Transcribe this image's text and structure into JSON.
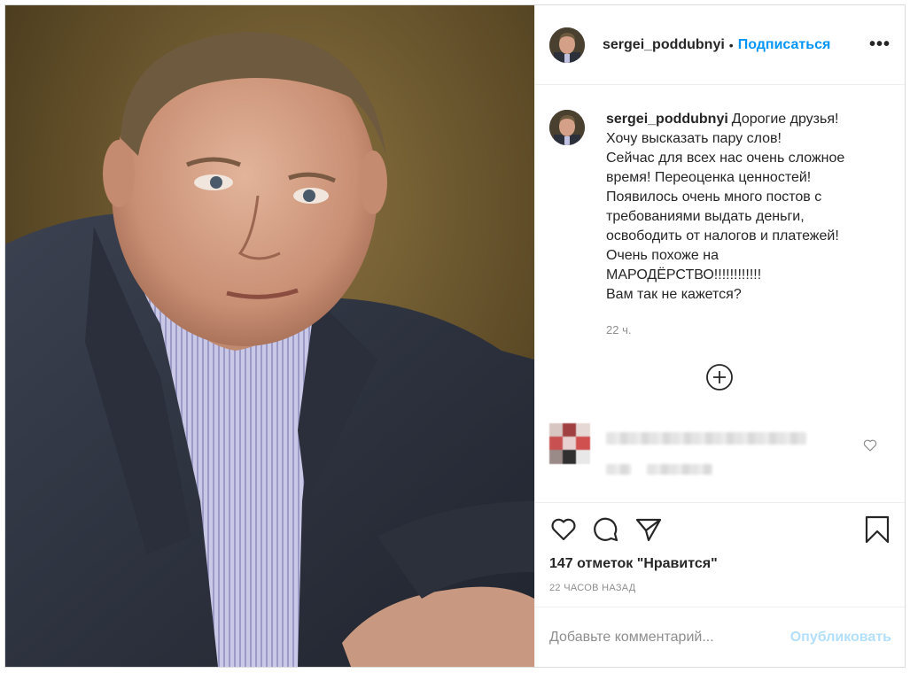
{
  "header": {
    "username": "sergei_poddubnyi",
    "separator": "•",
    "follow_label": "Подписаться",
    "more_label": "•••"
  },
  "caption": {
    "username": "sergei_poddubnyi",
    "lines": [
      "Дорогие друзья!",
      "Хочу высказать пару слов!",
      "Сейчас для всех нас очень сложное",
      "время! Переоценка ценностей!",
      "Появилось очень много постов с",
      "требованиями выдать деньги,",
      "освободить от налогов и платежей!",
      "Очень похоже на",
      "МАРОДЁРСТВО!!!!!!!!!!!!",
      "Вам так не кажется?"
    ],
    "time": "22 ч."
  },
  "actions": {
    "likes": "147 отметок \"Нравится\"",
    "post_time": "22 ЧАСОВ НАЗАД"
  },
  "comment_box": {
    "placeholder": "Добавьте комментарий...",
    "publish_label": "Опубликовать"
  },
  "colors": {
    "accent": "#0095f6",
    "publish_disabled": "#b2dffc",
    "muted": "#8e8e8e",
    "text": "#262626",
    "border": "#dbdbdb"
  },
  "icons": {
    "more": "more-options-icon",
    "load_more": "plus-circle-icon",
    "like": "heart-icon",
    "comment": "comment-icon",
    "share": "share-icon",
    "save": "bookmark-icon",
    "comment_like": "heart-icon"
  }
}
